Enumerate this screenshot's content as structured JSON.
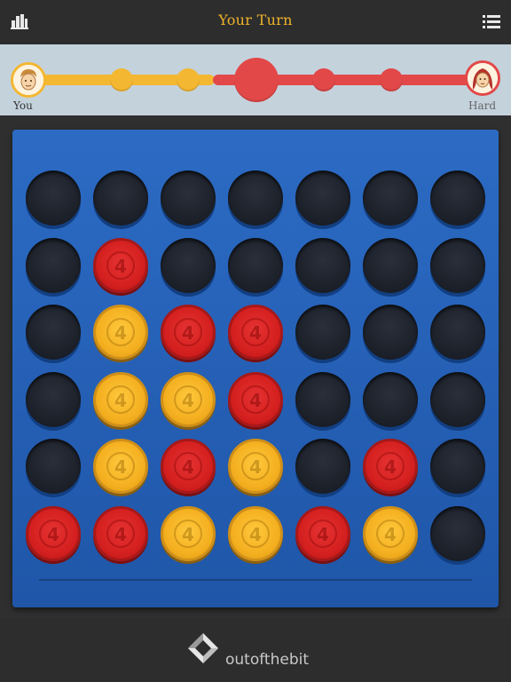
{
  "header": {
    "title": "Your Turn",
    "left_icon": "leaderboard-icon",
    "right_icon": "menu-icon"
  },
  "players": {
    "you": {
      "label": "You",
      "color": "#f4b731"
    },
    "opponent": {
      "label": "Hard",
      "color": "#e24848"
    }
  },
  "board": {
    "rows": 6,
    "cols": 7,
    "cells": [
      [
        "empty",
        "empty",
        "empty",
        "empty",
        "empty",
        "empty",
        "empty"
      ],
      [
        "empty",
        "red",
        "empty",
        "empty",
        "empty",
        "empty",
        "empty"
      ],
      [
        "empty",
        "yellow",
        "red",
        "red",
        "empty",
        "empty",
        "empty"
      ],
      [
        "empty",
        "yellow",
        "yellow",
        "red",
        "empty",
        "empty",
        "empty"
      ],
      [
        "empty",
        "yellow",
        "red",
        "yellow",
        "empty",
        "red",
        "empty"
      ],
      [
        "red",
        "red",
        "yellow",
        "yellow",
        "red",
        "yellow",
        "empty"
      ]
    ],
    "colors": {
      "board": "#2660b8",
      "red": "#d52020",
      "yellow": "#f4b020"
    }
  },
  "footer": {
    "brand": "outofthebit",
    "logo_icon": "outofthebit-logo-icon"
  }
}
